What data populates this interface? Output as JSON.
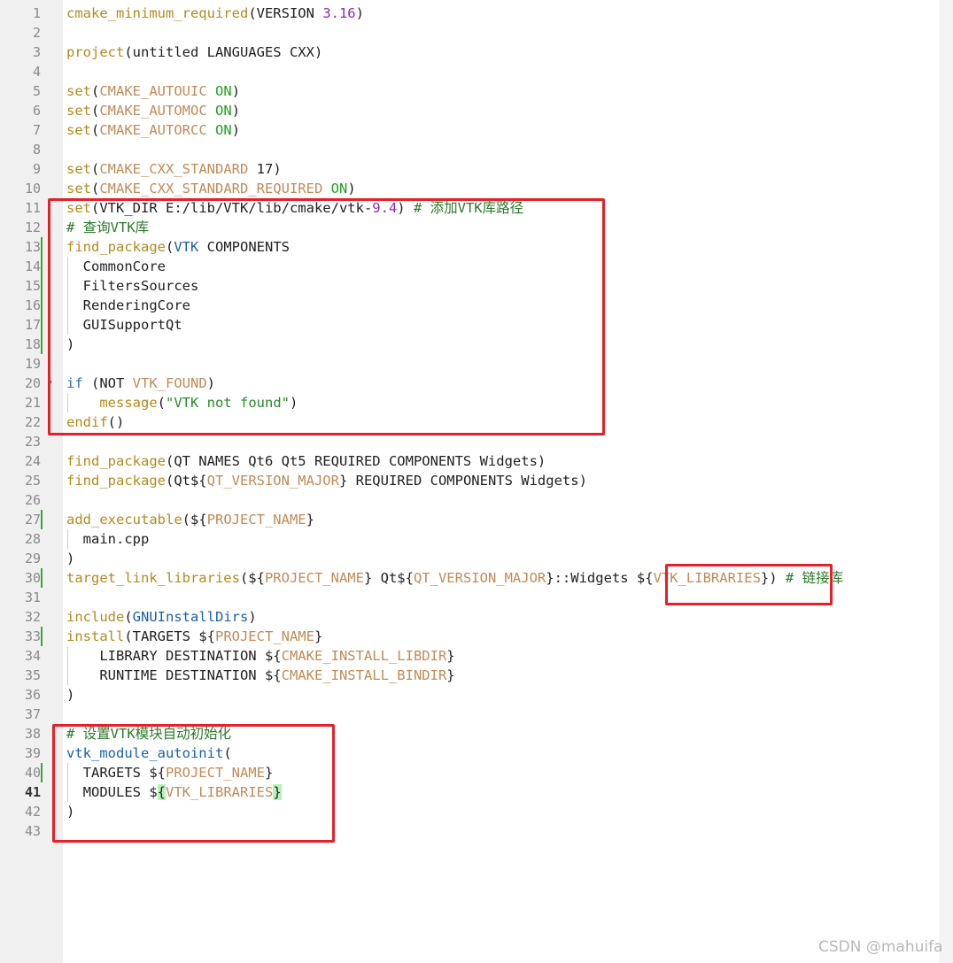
{
  "colors": {
    "default": "#1f1f1f",
    "function": "#b38a1f",
    "variable": "#c08a58",
    "keyword_value": "#22a022",
    "number": "#8a2bb5",
    "string": "#2a8a2a",
    "comment": "#2a7a2a",
    "builtin": "#1a5fa8",
    "control": "#2d6fb5",
    "highlight_box": "#e5202a"
  },
  "current_line": 41,
  "lines": [
    {
      "n": 1,
      "tokens": [
        [
          "cmake_minimum_required",
          "function"
        ],
        [
          "(VERSION ",
          "default"
        ],
        [
          "3.16",
          "number"
        ],
        [
          ")",
          "default"
        ]
      ]
    },
    {
      "n": 2,
      "tokens": []
    },
    {
      "n": 3,
      "tokens": [
        [
          "project",
          "function"
        ],
        [
          "(untitled LANGUAGES CXX)",
          "default"
        ]
      ]
    },
    {
      "n": 4,
      "tokens": []
    },
    {
      "n": 5,
      "tokens": [
        [
          "set",
          "function"
        ],
        [
          "(",
          "default"
        ],
        [
          "CMAKE_AUTOUIC",
          "variable"
        ],
        [
          " ",
          "default"
        ],
        [
          "ON",
          "keyword_value"
        ],
        [
          ")",
          "default"
        ]
      ]
    },
    {
      "n": 6,
      "tokens": [
        [
          "set",
          "function"
        ],
        [
          "(",
          "default"
        ],
        [
          "CMAKE_AUTOMOC",
          "variable"
        ],
        [
          " ",
          "default"
        ],
        [
          "ON",
          "keyword_value"
        ],
        [
          ")",
          "default"
        ]
      ]
    },
    {
      "n": 7,
      "tokens": [
        [
          "set",
          "function"
        ],
        [
          "(",
          "default"
        ],
        [
          "CMAKE_AUTORCC",
          "variable"
        ],
        [
          " ",
          "default"
        ],
        [
          "ON",
          "keyword_value"
        ],
        [
          ")",
          "default"
        ]
      ]
    },
    {
      "n": 8,
      "tokens": []
    },
    {
      "n": 9,
      "tokens": [
        [
          "set",
          "function"
        ],
        [
          "(",
          "default"
        ],
        [
          "CMAKE_CXX_STANDARD",
          "variable"
        ],
        [
          " 17)",
          "default"
        ]
      ]
    },
    {
      "n": 10,
      "tokens": [
        [
          "set",
          "function"
        ],
        [
          "(",
          "default"
        ],
        [
          "CMAKE_CXX_STANDARD_REQUIRED",
          "variable"
        ],
        [
          " ",
          "default"
        ],
        [
          "ON",
          "keyword_value"
        ],
        [
          ")",
          "default"
        ]
      ]
    },
    {
      "n": 11,
      "tokens": [
        [
          "set",
          "function"
        ],
        [
          "(VTK_DIR E:/lib/VTK/lib/cmake/vtk-",
          "default"
        ],
        [
          "9.4",
          "number"
        ],
        [
          ") ",
          "default"
        ],
        [
          "# 添加VTK库路径",
          "comment"
        ]
      ]
    },
    {
      "n": 12,
      "tokens": [
        [
          "# 查询VTK库",
          "comment"
        ]
      ]
    },
    {
      "n": 13,
      "tokens": [
        [
          "find_package",
          "function"
        ],
        [
          "(",
          "default"
        ],
        [
          "VTK",
          "builtin"
        ],
        [
          " COMPONENTS",
          "default"
        ]
      ]
    },
    {
      "n": 14,
      "tokens": [
        [
          "  CommonCore",
          "default"
        ]
      ]
    },
    {
      "n": 15,
      "tokens": [
        [
          "  FiltersSources",
          "default"
        ]
      ]
    },
    {
      "n": 16,
      "tokens": [
        [
          "  RenderingCore",
          "default"
        ]
      ]
    },
    {
      "n": 17,
      "tokens": [
        [
          "  GUISupportQt",
          "default"
        ]
      ]
    },
    {
      "n": 18,
      "tokens": [
        [
          ")",
          "default"
        ]
      ]
    },
    {
      "n": 19,
      "tokens": []
    },
    {
      "n": 20,
      "tokens": [
        [
          "if",
          "control"
        ],
        [
          " (NOT ",
          "default"
        ],
        [
          "VTK_FOUND",
          "variable"
        ],
        [
          ")",
          "default"
        ]
      ]
    },
    {
      "n": 21,
      "tokens": [
        [
          "    ",
          "default"
        ],
        [
          "message",
          "function"
        ],
        [
          "(",
          "default"
        ],
        [
          "\"VTK not found\"",
          "string"
        ],
        [
          ")",
          "default"
        ]
      ]
    },
    {
      "n": 22,
      "tokens": [
        [
          "endif",
          "function"
        ],
        [
          "()",
          "default"
        ]
      ]
    },
    {
      "n": 23,
      "tokens": []
    },
    {
      "n": 24,
      "tokens": [
        [
          "find_package",
          "function"
        ],
        [
          "(QT NAMES Qt6 Qt5 REQUIRED COMPONENTS Widgets)",
          "default"
        ]
      ]
    },
    {
      "n": 25,
      "tokens": [
        [
          "find_package",
          "function"
        ],
        [
          "(Qt${",
          "default"
        ],
        [
          "QT_VERSION_MAJOR",
          "variable"
        ],
        [
          "} REQUIRED COMPONENTS Widgets)",
          "default"
        ]
      ]
    },
    {
      "n": 26,
      "tokens": []
    },
    {
      "n": 27,
      "tokens": [
        [
          "add_executable",
          "function"
        ],
        [
          "(${",
          "default"
        ],
        [
          "PROJECT_NAME",
          "variable"
        ],
        [
          "}",
          "default"
        ]
      ]
    },
    {
      "n": 28,
      "tokens": [
        [
          "  main.cpp",
          "default"
        ]
      ]
    },
    {
      "n": 29,
      "tokens": [
        [
          ")",
          "default"
        ]
      ]
    },
    {
      "n": 30,
      "tokens": [
        [
          "target_link_libraries",
          "function"
        ],
        [
          "(${",
          "default"
        ],
        [
          "PROJECT_NAME",
          "variable"
        ],
        [
          "} Qt${",
          "default"
        ],
        [
          "QT_VERSION_MAJOR",
          "variable"
        ],
        [
          "}::Widgets ${",
          "default"
        ],
        [
          "VTK_LIBRARIES",
          "variable"
        ],
        [
          "}) ",
          "default"
        ],
        [
          "# 链接库",
          "comment"
        ]
      ]
    },
    {
      "n": 31,
      "tokens": []
    },
    {
      "n": 32,
      "tokens": [
        [
          "include",
          "function"
        ],
        [
          "(",
          "default"
        ],
        [
          "GNUInstallDirs",
          "builtin"
        ],
        [
          ")",
          "default"
        ]
      ]
    },
    {
      "n": 33,
      "tokens": [
        [
          "install",
          "function"
        ],
        [
          "(TARGETS ${",
          "default"
        ],
        [
          "PROJECT_NAME",
          "variable"
        ],
        [
          "}",
          "default"
        ]
      ]
    },
    {
      "n": 34,
      "tokens": [
        [
          "    LIBRARY DESTINATION ${",
          "default"
        ],
        [
          "CMAKE_INSTALL_LIBDIR",
          "variable"
        ],
        [
          "}",
          "default"
        ]
      ]
    },
    {
      "n": 35,
      "tokens": [
        [
          "    RUNTIME DESTINATION ${",
          "default"
        ],
        [
          "CMAKE_INSTALL_BINDIR",
          "variable"
        ],
        [
          "}",
          "default"
        ]
      ]
    },
    {
      "n": 36,
      "tokens": [
        [
          ")",
          "default"
        ]
      ]
    },
    {
      "n": 37,
      "tokens": []
    },
    {
      "n": 38,
      "tokens": [
        [
          "# 设置VTK模块自动初始化",
          "comment"
        ]
      ]
    },
    {
      "n": 39,
      "tokens": [
        [
          "vtk_module_autoinit",
          "builtin"
        ],
        [
          "(",
          "default"
        ]
      ]
    },
    {
      "n": 40,
      "tokens": [
        [
          "  TARGETS ${",
          "default"
        ],
        [
          "PROJECT_NAME",
          "variable"
        ],
        [
          "}",
          "default"
        ]
      ]
    },
    {
      "n": 41,
      "tokens": [
        [
          "  MODULES $",
          "default"
        ],
        [
          "{",
          "bracket"
        ],
        [
          "VTK_LIBRARIES",
          "variable"
        ],
        [
          "}",
          "bracket"
        ]
      ]
    },
    {
      "n": 42,
      "tokens": [
        [
          ")",
          "default"
        ]
      ]
    },
    {
      "n": 43,
      "tokens": []
    }
  ],
  "modified_lines": [
    13,
    14,
    15,
    16,
    17,
    18,
    27,
    30,
    33,
    40
  ],
  "fold_lines": [
    20
  ],
  "watermark": "CSDN @mahuifa"
}
